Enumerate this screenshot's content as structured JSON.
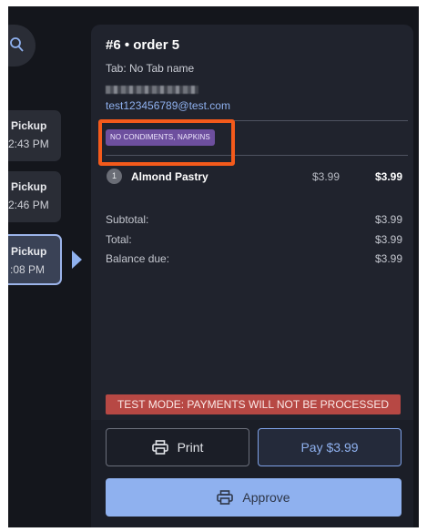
{
  "sidebar": {
    "orders": [
      {
        "type": "Pickup",
        "time": "2:43 PM"
      },
      {
        "type": "Pickup",
        "time": "2:46 PM"
      },
      {
        "type": "Pickup",
        "time": ":08 PM"
      }
    ]
  },
  "order": {
    "title": "#6 • order 5",
    "tab_label": "Tab: No Tab name",
    "email": "test123456789@test.com",
    "note_badge": "NO CONDIMENTS, NAPKINS",
    "items": [
      {
        "qty": "1",
        "name": "Almond Pastry",
        "unit_price": "$3.99",
        "total": "$3.99"
      }
    ],
    "summary": {
      "subtotal_label": "Subtotal:",
      "subtotal": "$3.99",
      "total_label": "Total:",
      "total": "$3.99",
      "balance_label": "Balance due:",
      "balance": "$3.99"
    },
    "test_mode_banner": "TEST MODE:  PAYMENTS WILL NOT BE PROCESSED"
  },
  "actions": {
    "print_label": "Print",
    "pay_label": "Pay $3.99",
    "approve_label": "Approve"
  },
  "colors": {
    "accent": "#8fb1ef",
    "badge": "#6d4f9e",
    "test_banner": "#b74844",
    "highlight_box": "#f45a1b"
  },
  "icons": [
    "search-icon",
    "printer-icon",
    "printer-icon"
  ]
}
